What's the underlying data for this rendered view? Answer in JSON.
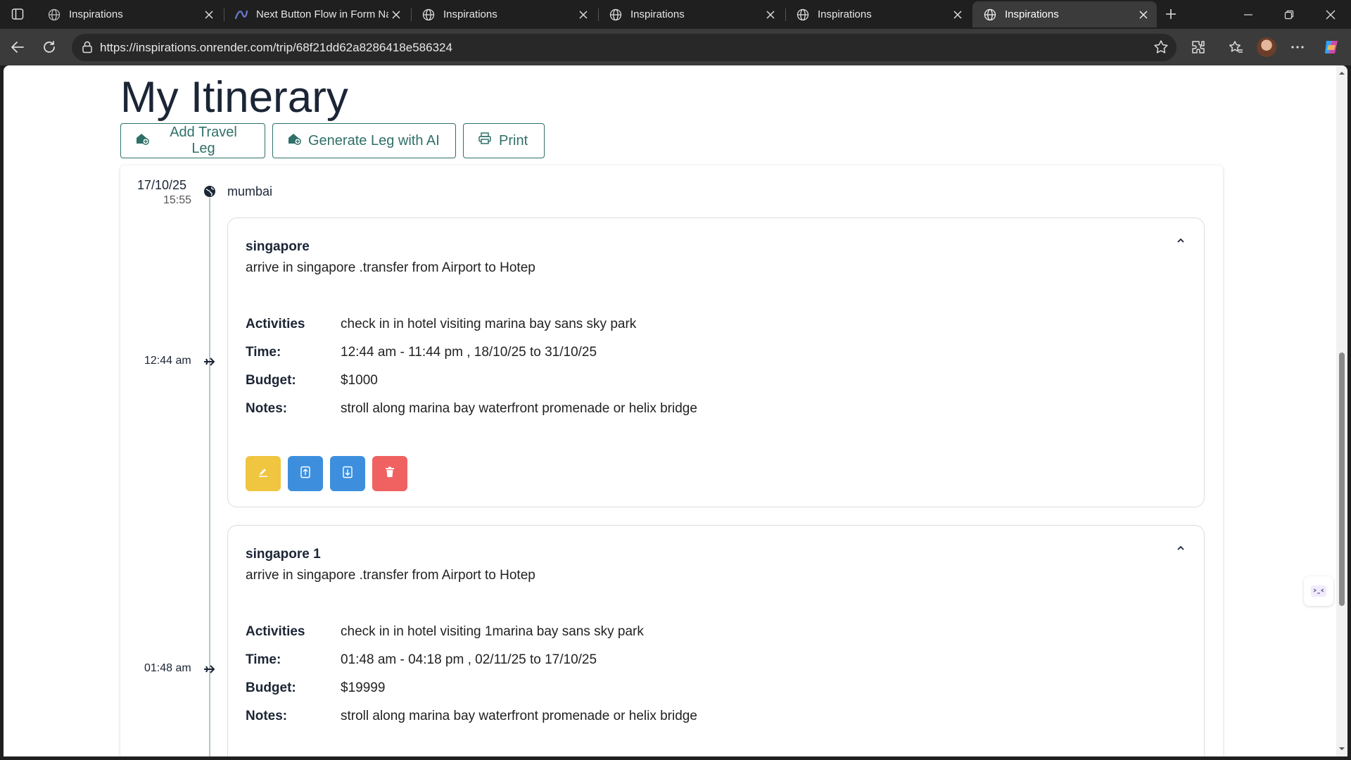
{
  "browser": {
    "tabs": [
      {
        "title": "Inspirations",
        "favicon": "globe-icon"
      },
      {
        "title": "Next Button Flow in Form Na",
        "favicon": "claude-icon"
      },
      {
        "title": "Inspirations",
        "favicon": "globe-icon"
      },
      {
        "title": "Inspirations",
        "favicon": "globe-icon"
      },
      {
        "title": "Inspirations",
        "favicon": "globe-icon"
      },
      {
        "title": "Inspirations",
        "favicon": "globe-icon",
        "active": true
      }
    ],
    "url": "https://inspirations.onrender.com/trip/68f21dd62a8286418e586324"
  },
  "page": {
    "title": "My Itinerary",
    "actions": {
      "add_leg": "Add Travel Leg",
      "generate_leg": "Generate Leg with AI",
      "print": "Print"
    }
  },
  "itinerary": {
    "start": {
      "date": "17/10/25",
      "time": "15:55",
      "location": "mumbai"
    },
    "labels": {
      "activities": "Activities",
      "time": "Time:",
      "budget": "Budget:",
      "notes": "Notes:"
    },
    "legs": [
      {
        "timeline_time": "12:44 am",
        "name": "singapore",
        "description": "arrive in singapore .transfer from Airport to Hotep",
        "activities": "check in in hotel visiting marina bay sans sky park",
        "time": "12:44 am - 11:44 pm , 18/10/25 to 31/10/25",
        "budget": "$1000",
        "notes": "stroll along marina bay waterfront promenade or helix bridge"
      },
      {
        "timeline_time": "01:48 am",
        "name": "singapore 1",
        "description": "arrive in singapore .transfer from Airport to Hotep",
        "activities": "check in in hotel visiting 1marina bay sans sky park",
        "time": "01:48 am - 04:18 pm , 02/11/25 to 17/10/25",
        "budget": "$19999",
        "notes": "stroll along marina bay waterfront promenade or helix bridge"
      }
    ]
  },
  "colors": {
    "accent": "#2f7068",
    "edit": "#f0c540",
    "move": "#3d8fde",
    "delete": "#f06262"
  }
}
